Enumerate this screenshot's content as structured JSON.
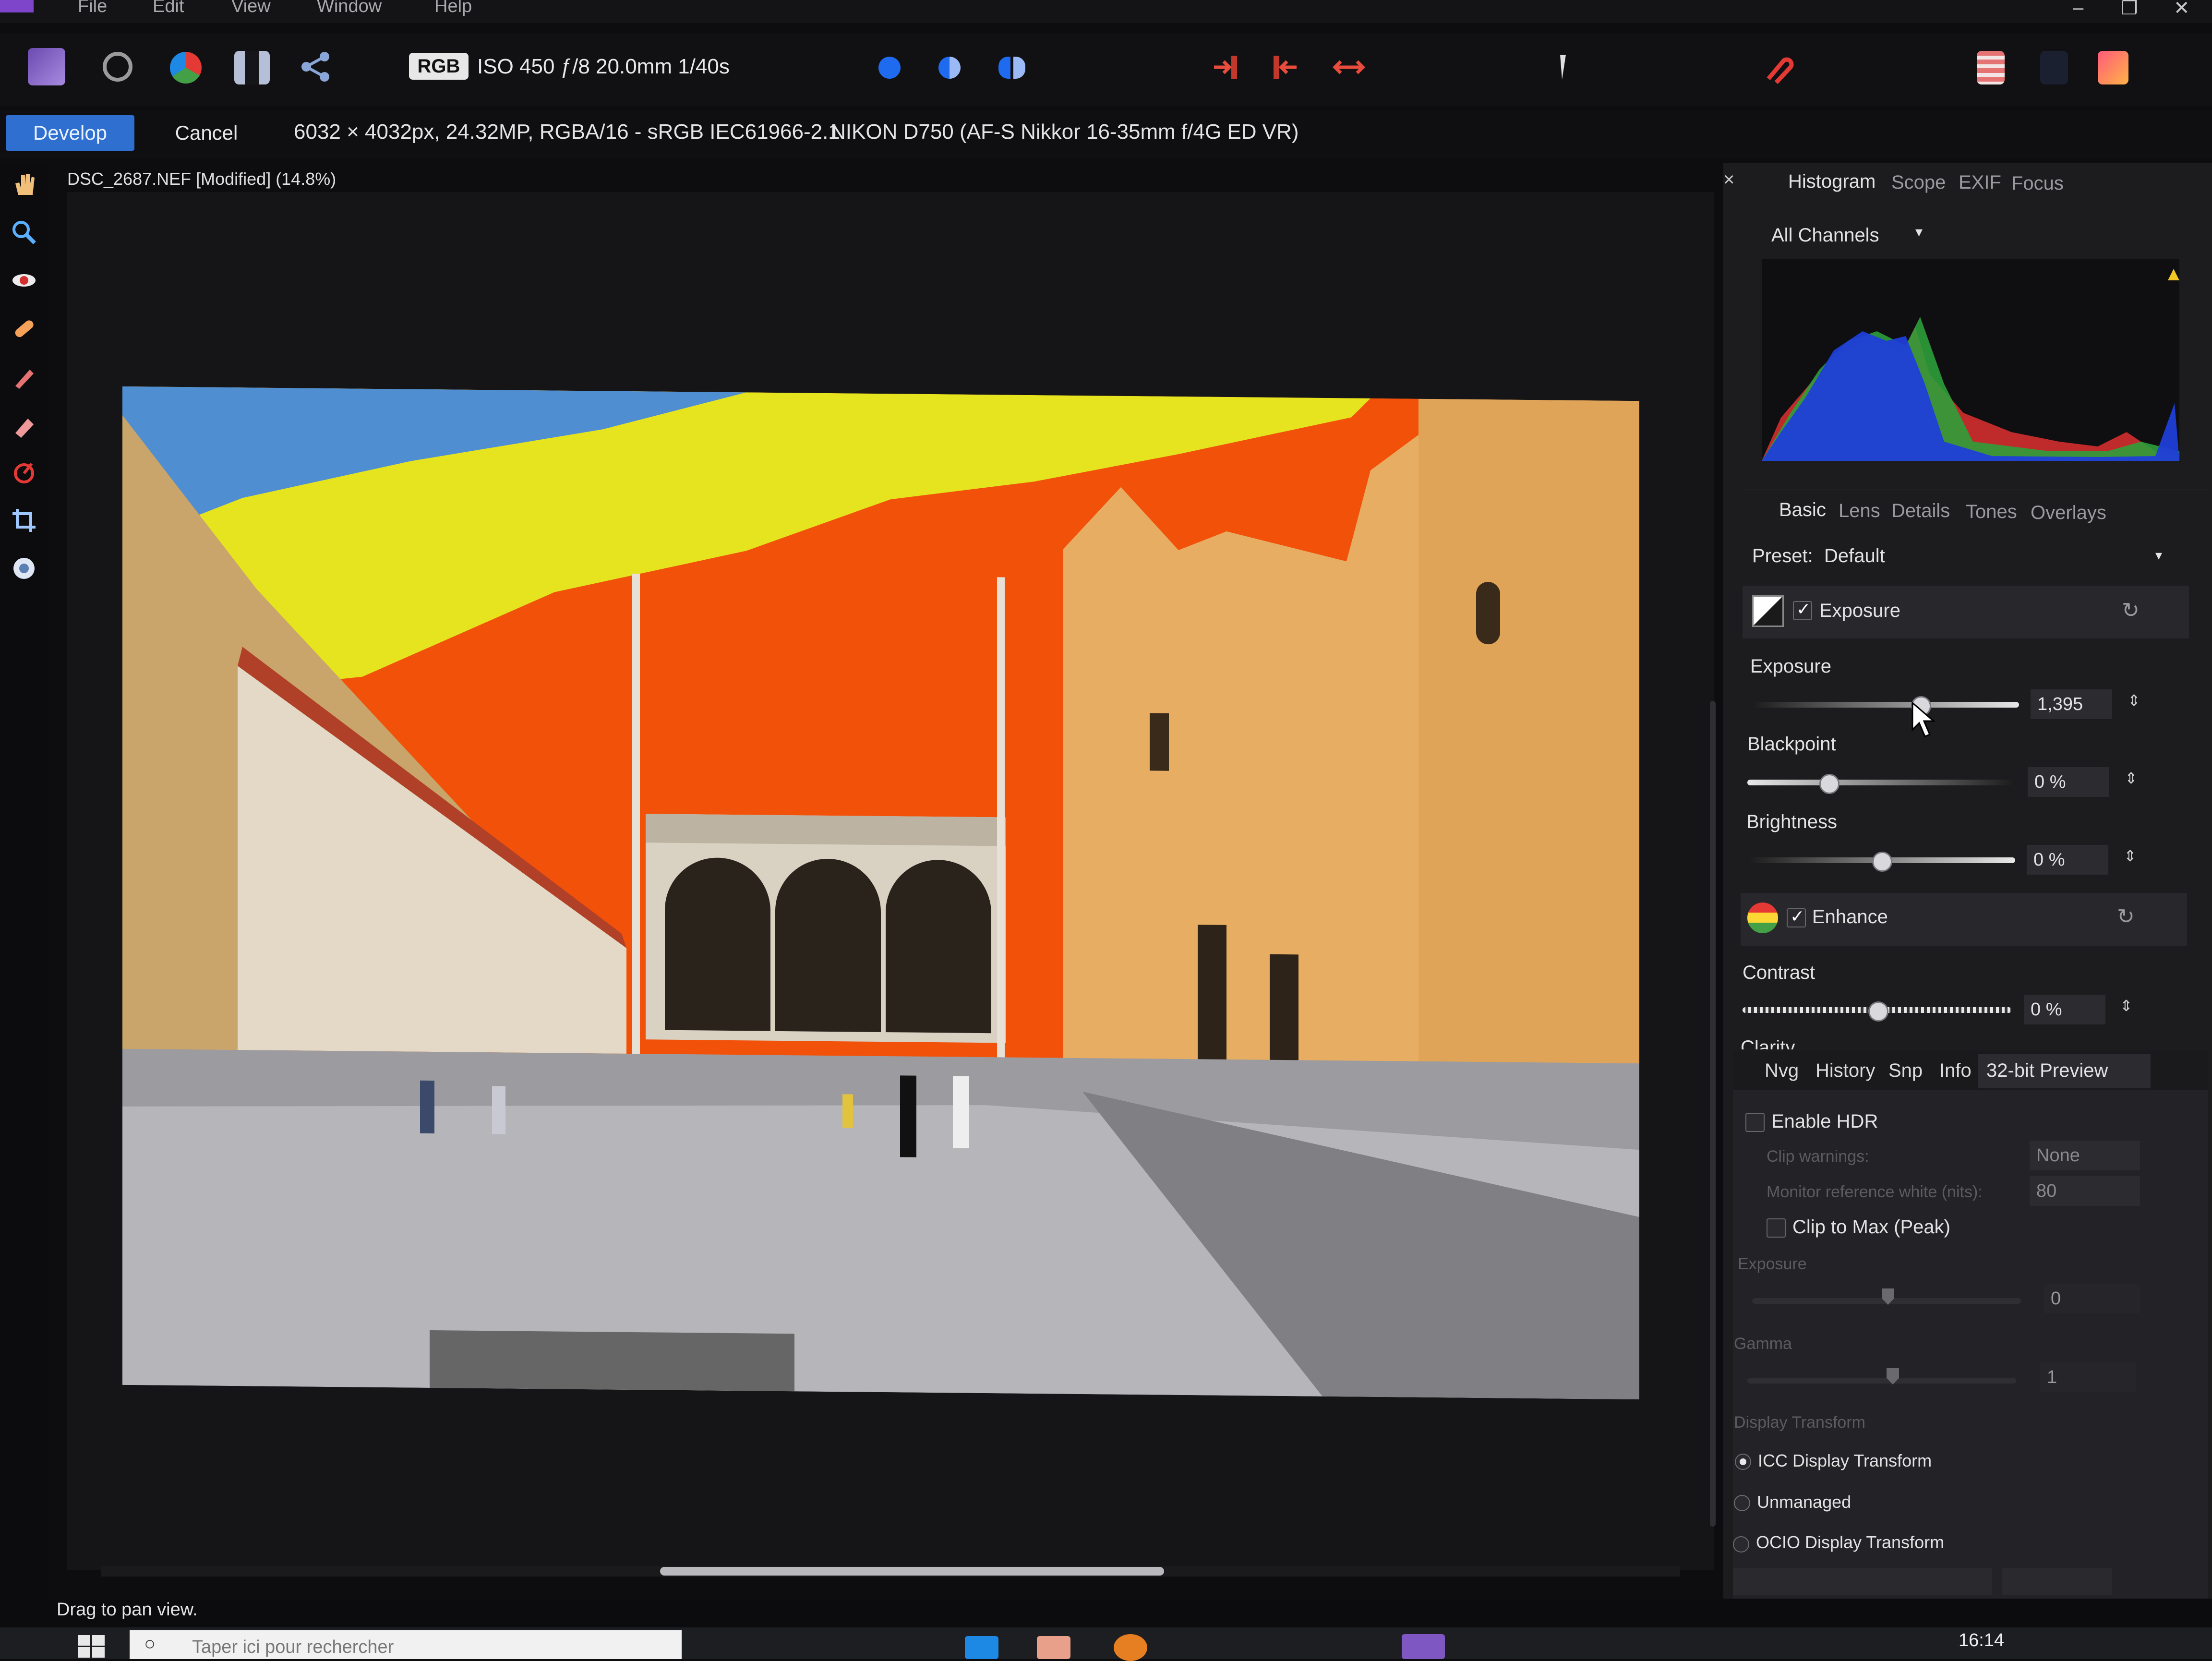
{
  "menu": {
    "items": [
      "File",
      "Edit",
      "View",
      "Window",
      "Help"
    ]
  },
  "context": {
    "develop_label": "Develop",
    "cancel_label": "Cancel",
    "image_info": "6032 × 4032px, 24.32MP, RGBA/16 - sRGB IEC61966-2.1",
    "camera_info": "NIKON D750 (AF-S Nikkor 16-35mm f/4G ED VR)"
  },
  "toolbar": {
    "colorspace_badge": "RGB",
    "exif_summary": "ISO 450 ƒ/8 20.0mm 1/40s"
  },
  "document": {
    "title": "DSC_2687.NEF [Modified] (14.8%)"
  },
  "histogram_panel": {
    "close_glyph": "×",
    "tabs": [
      "Histogram",
      "Scope",
      "EXIF",
      "Focus"
    ],
    "channel": "All Channels"
  },
  "adjust_panel": {
    "tabs": [
      "Basic",
      "Lens",
      "Details",
      "Tones",
      "Overlays"
    ],
    "preset_label": "Preset:",
    "preset_value": "Default",
    "exposure_section": {
      "title": "Exposure",
      "enabled": true
    },
    "sliders": [
      {
        "name": "Exposure",
        "value_text": "1,395",
        "position": 0.63
      },
      {
        "name": "Blackpoint",
        "value_text": "0 %",
        "position": 0.3
      },
      {
        "name": "Brightness",
        "value_text": "0 %",
        "position": 0.5
      }
    ],
    "enhance_section": {
      "title": "Enhance",
      "enabled": true
    },
    "contrast": {
      "name": "Contrast",
      "value_text": "0 %",
      "position": 0.5
    },
    "clarity_label": "Clarity"
  },
  "preview_panel": {
    "tabs": [
      "Nvg",
      "History",
      "Snp",
      "Info",
      "32-bit Preview"
    ],
    "enable_hdr_label": "Enable HDR",
    "clip_warnings_label": "Clip warnings:",
    "clip_warnings_value": "None",
    "monitor_white_label": "Monitor reference white (nits):",
    "monitor_white_value": "80",
    "clip_to_max_label": "Clip to Max (Peak)",
    "exposure_label": "Exposure",
    "exposure_value": "0",
    "gamma_label": "Gamma",
    "gamma_value": "1",
    "display_transform_label": "Display Transform",
    "transforms": [
      {
        "label": "ICC Display Transform",
        "selected": true
      },
      {
        "label": "Unmanaged",
        "selected": false
      },
      {
        "label": "OCIO Display Transform",
        "selected": false
      }
    ]
  },
  "status": {
    "hint": "Drag to pan view."
  },
  "taskbar": {
    "search_placeholder": "Taper ici pour rechercher",
    "time": "16:14"
  },
  "colors": {
    "accent": "#2f6fd0",
    "sky_yellow": "#e6e41e",
    "sky_orange": "#f2510a",
    "sky_blue": "#4f8ed0"
  }
}
